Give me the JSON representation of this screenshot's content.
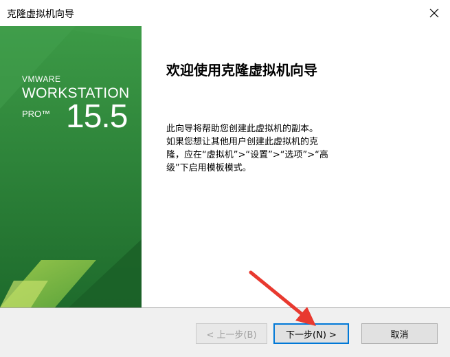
{
  "window": {
    "title": "克隆虚拟机向导"
  },
  "banner": {
    "vendor": "VMWARE",
    "product": "WORKSTATION",
    "edition": "PRO™",
    "version": "15.5"
  },
  "main": {
    "heading": "欢迎使用克隆虚拟机向导",
    "description_lines": [
      "此向导将帮助您创建此虚拟机的副本。",
      "如果您想让其他用户创建此虚拟机的克",
      "隆，应在“虚拟机”>“设置”>“选项”>“高",
      "级”下启用模板模式。"
    ]
  },
  "buttons": {
    "back": "< 上一步(B)",
    "next": "下一步(N) >",
    "cancel": "取消"
  },
  "colors": {
    "banner_green": "#2f8a3c",
    "banner_dark": "#1e6b2c",
    "arrow_red": "#e8392f",
    "focus_blue": "#0078d7"
  },
  "icons": [
    "close-icon",
    "annotation-arrow"
  ]
}
